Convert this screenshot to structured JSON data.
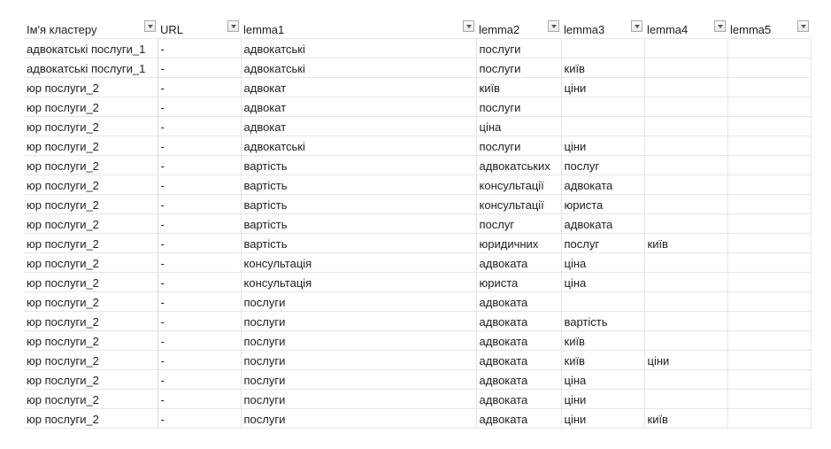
{
  "headers": [
    "Ім'я кластеру",
    "URL",
    "lemma1",
    "lemma2",
    "lemma3",
    "lemma4",
    "lemma5"
  ],
  "filter_icon": "dropdown-arrow-icon",
  "rows": [
    [
      "адвокатські послуги_1",
      "-",
      "адвокатські",
      "послуги",
      "",
      "",
      ""
    ],
    [
      "адвокатські послуги_1",
      "-",
      "адвокатські",
      "послуги",
      "київ",
      "",
      ""
    ],
    [
      "юр послуги_2",
      "-",
      "адвокат",
      "київ",
      "ціни",
      "",
      ""
    ],
    [
      "юр послуги_2",
      "-",
      "адвокат",
      "послуги",
      "",
      "",
      ""
    ],
    [
      "юр послуги_2",
      "-",
      "адвокат",
      "ціна",
      "",
      "",
      ""
    ],
    [
      "юр послуги_2",
      "-",
      "адвокатські",
      "послуги",
      "ціни",
      "",
      ""
    ],
    [
      "юр послуги_2",
      "-",
      "вартість",
      "адвокатських",
      "послуг",
      "",
      ""
    ],
    [
      "юр послуги_2",
      "-",
      "вартість",
      "консультації",
      "адвоката",
      "",
      ""
    ],
    [
      "юр послуги_2",
      "-",
      "вартість",
      "консультації",
      "юриста",
      "",
      ""
    ],
    [
      "юр послуги_2",
      "-",
      "вартість",
      "послуг",
      "адвоката",
      "",
      ""
    ],
    [
      "юр послуги_2",
      "-",
      "вартість",
      "юридичних",
      "послуг",
      "київ",
      ""
    ],
    [
      "юр послуги_2",
      "-",
      "консультація",
      "адвоката",
      "ціна",
      "",
      ""
    ],
    [
      "юр послуги_2",
      "-",
      "консультація",
      "юриста",
      "ціна",
      "",
      ""
    ],
    [
      "юр послуги_2",
      "-",
      "послуги",
      "адвоката",
      "",
      "",
      ""
    ],
    [
      "юр послуги_2",
      "-",
      "послуги",
      "адвоката",
      "вартість",
      "",
      ""
    ],
    [
      "юр послуги_2",
      "-",
      "послуги",
      "адвоката",
      "київ",
      "",
      ""
    ],
    [
      "юр послуги_2",
      "-",
      "послуги",
      "адвоката",
      "київ",
      "ціни",
      ""
    ],
    [
      "юр послуги_2",
      "-",
      "послуги",
      "адвоката",
      "ціна",
      "",
      ""
    ],
    [
      "юр послуги_2",
      "-",
      "послуги",
      "адвоката",
      "ціни",
      "",
      ""
    ],
    [
      "юр послуги_2",
      "-",
      "послуги",
      "адвоката",
      "ціни",
      "київ",
      ""
    ]
  ]
}
